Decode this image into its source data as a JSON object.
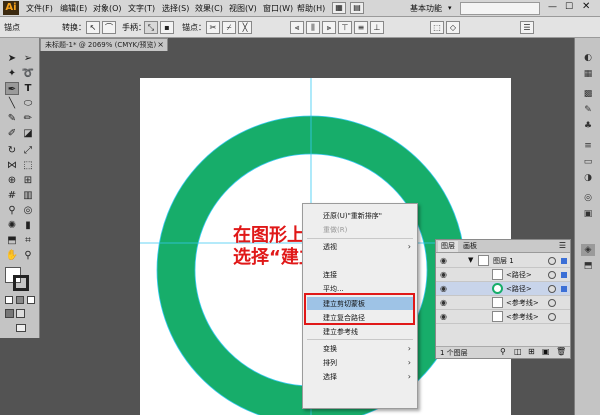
{
  "menubar": {
    "logo": "Ai",
    "items": [
      "文件(F)",
      "编辑(E)",
      "对象(O)",
      "文字(T)",
      "选择(S)",
      "效果(C)",
      "视图(V)",
      "窗口(W)",
      "帮助(H)"
    ],
    "workspace": "基本功能"
  },
  "controlbar": {
    "anchor_label": "锚点",
    "convert_label": "转换：",
    "handle_label": "手柄：",
    "anchor_right_label": "锚点："
  },
  "document_tab": {
    "title": "未标题-1* @ 2069% (CMYK/预览)"
  },
  "context_menu": {
    "items": [
      {
        "label": "还原(U)\"重新排序\"",
        "disabled": false
      },
      {
        "label": "重做(R)",
        "disabled": true
      },
      {
        "label": "透视",
        "disabled": false
      },
      {
        "label": "连接",
        "disabled": false
      },
      {
        "label": "平均...",
        "disabled": false
      },
      {
        "label": "建立剪切蒙板",
        "disabled": false,
        "highlighted": true
      },
      {
        "label": "建立复合路径",
        "disabled": false
      },
      {
        "label": "建立参考线",
        "disabled": false
      },
      {
        "label": "变换",
        "submenu": true
      },
      {
        "label": "排列",
        "submenu": true
      },
      {
        "label": "选择",
        "submenu": true
      }
    ]
  },
  "annotation": {
    "line1": "在图形上右击鼠标，",
    "line2": "选择“建立剪切蒙板”"
  },
  "layers_panel": {
    "tab_layers": "图层",
    "tab_artboards": "画板",
    "rows": [
      {
        "name": "图层 1"
      },
      {
        "name": "<路径>"
      },
      {
        "name": "<路径>"
      },
      {
        "name": "<参考线>"
      },
      {
        "name": "<参考线>"
      }
    ],
    "footer": "1 个图层"
  },
  "colors": {
    "ring": "#17ad6a",
    "guide": "#36c9f2",
    "highlight": "#9ec3e6",
    "annotation": "#e01818"
  }
}
